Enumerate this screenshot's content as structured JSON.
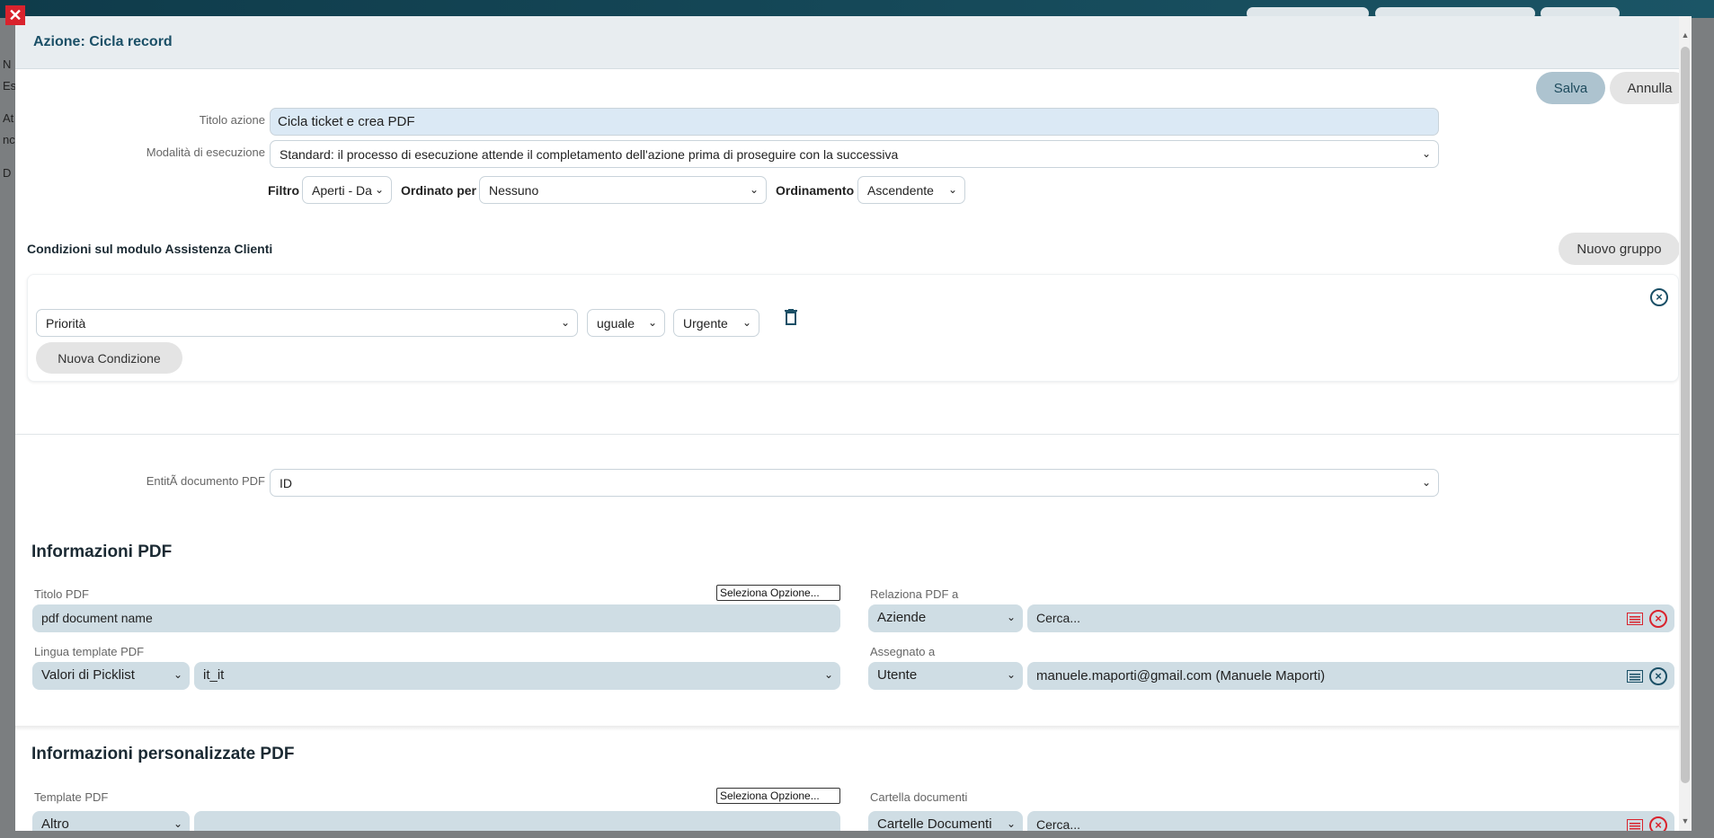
{
  "background": {
    "line1": "N",
    "line2": "Es",
    "line3": "At",
    "line4": "nc",
    "line5": "D"
  },
  "modal": {
    "title": "Azione: Cicla record",
    "save_label": "Salva",
    "cancel_label": "Annulla"
  },
  "form": {
    "title_label": "Titolo azione",
    "title_value": "Cicla ticket e crea PDF",
    "mode_label": "Modalità di esecuzione",
    "mode_value": "Standard: il processo di esecuzione attende il completamento dell'azione prima di proseguire con la successiva",
    "filter_label": "Filtro",
    "filter_value": "Aperti - Da",
    "order_by_label": "Ordinato per",
    "order_by_value": "Nessuno",
    "sort_label": "Ordinamento",
    "sort_value": "Ascendente"
  },
  "conditions": {
    "title": "Condizioni sul modulo Assistenza Clienti",
    "new_group_label": "Nuovo gruppo",
    "field_value": "Priorità",
    "operator_value": "uguale",
    "compare_value": "Urgente",
    "new_condition_label": "Nuova Condizione"
  },
  "entity": {
    "label": "EntitÃ  documento PDF",
    "value": "ID"
  },
  "pdf_info": {
    "section_title": "Informazioni PDF",
    "title_label": "Titolo PDF",
    "option_select": "Seleziona Opzione...",
    "title_value": "pdf document name",
    "relate_label": "Relaziona PDF a",
    "relate_module": "Aziende",
    "relate_search_placeholder": "Cerca...",
    "language_label": "Lingua template PDF",
    "language_source": "Valori di Picklist",
    "language_value": "it_it",
    "assigned_label": "Assegnato a",
    "assigned_type": "Utente",
    "assigned_value": "manuele.maporti@gmail.com (Manuele Maporti)"
  },
  "pdf_custom": {
    "section_title": "Informazioni personalizzate PDF",
    "template_label": "Template PDF",
    "option_select": "Seleziona Opzione...",
    "template_source": "Altro",
    "folder_label": "Cartella documenti",
    "folder_module": "Cartelle Documenti",
    "folder_search_placeholder": "Cerca..."
  },
  "colors": {
    "accent": "#1a4f66",
    "danger": "#d9232d",
    "field_bg": "#cfdde4"
  }
}
